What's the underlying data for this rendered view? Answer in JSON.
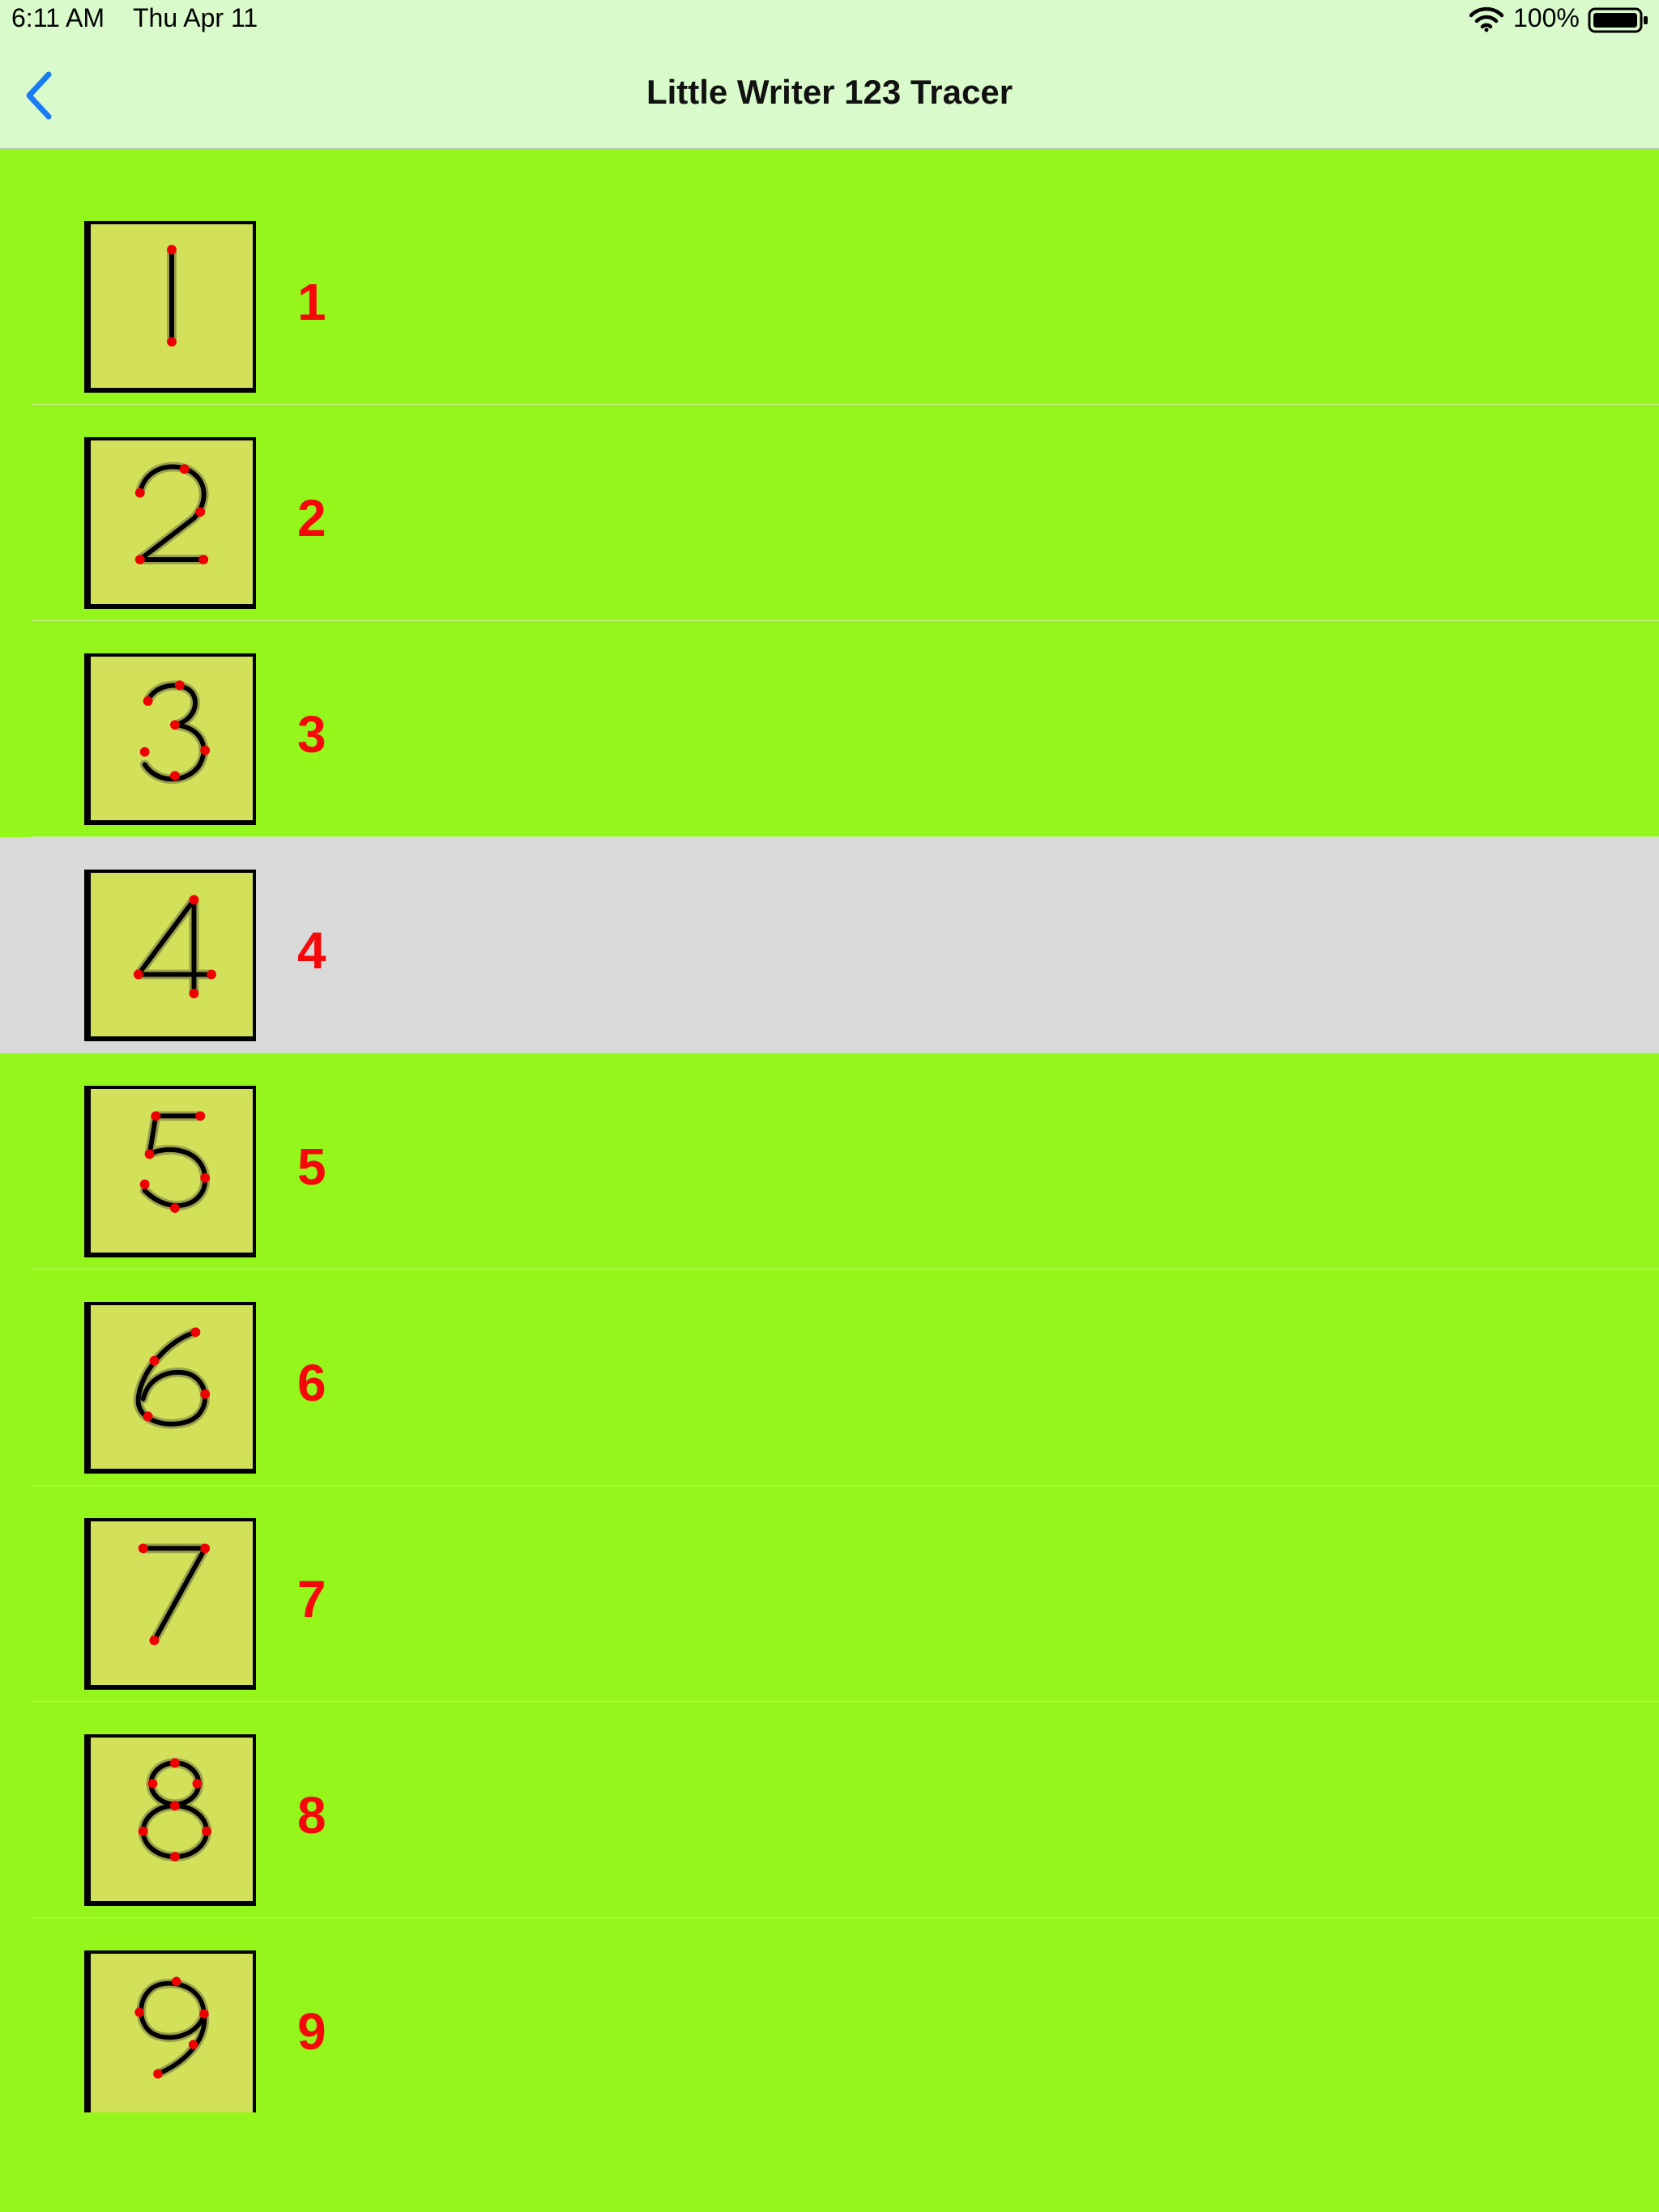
{
  "status_bar": {
    "time": "6:11 AM",
    "date": "Thu Apr 11",
    "battery_percent": "100%"
  },
  "nav": {
    "title": "Little Writer 123 Tracer",
    "back_icon": "chevron-left-icon"
  },
  "colors": {
    "list_background": "#95f61b",
    "selected_row": "#d9d9d9",
    "label_color": "#f5080a",
    "tile_background": "#d2e05a",
    "nav_background": "#d9facb",
    "back_tint": "#1a7cf5"
  },
  "rows": [
    {
      "label": "1",
      "selected": false
    },
    {
      "label": "2",
      "selected": false
    },
    {
      "label": "3",
      "selected": false
    },
    {
      "label": "4",
      "selected": true
    },
    {
      "label": "5",
      "selected": false
    },
    {
      "label": "6",
      "selected": false
    },
    {
      "label": "7",
      "selected": false
    },
    {
      "label": "8",
      "selected": false
    },
    {
      "label": "9",
      "selected": false
    }
  ]
}
